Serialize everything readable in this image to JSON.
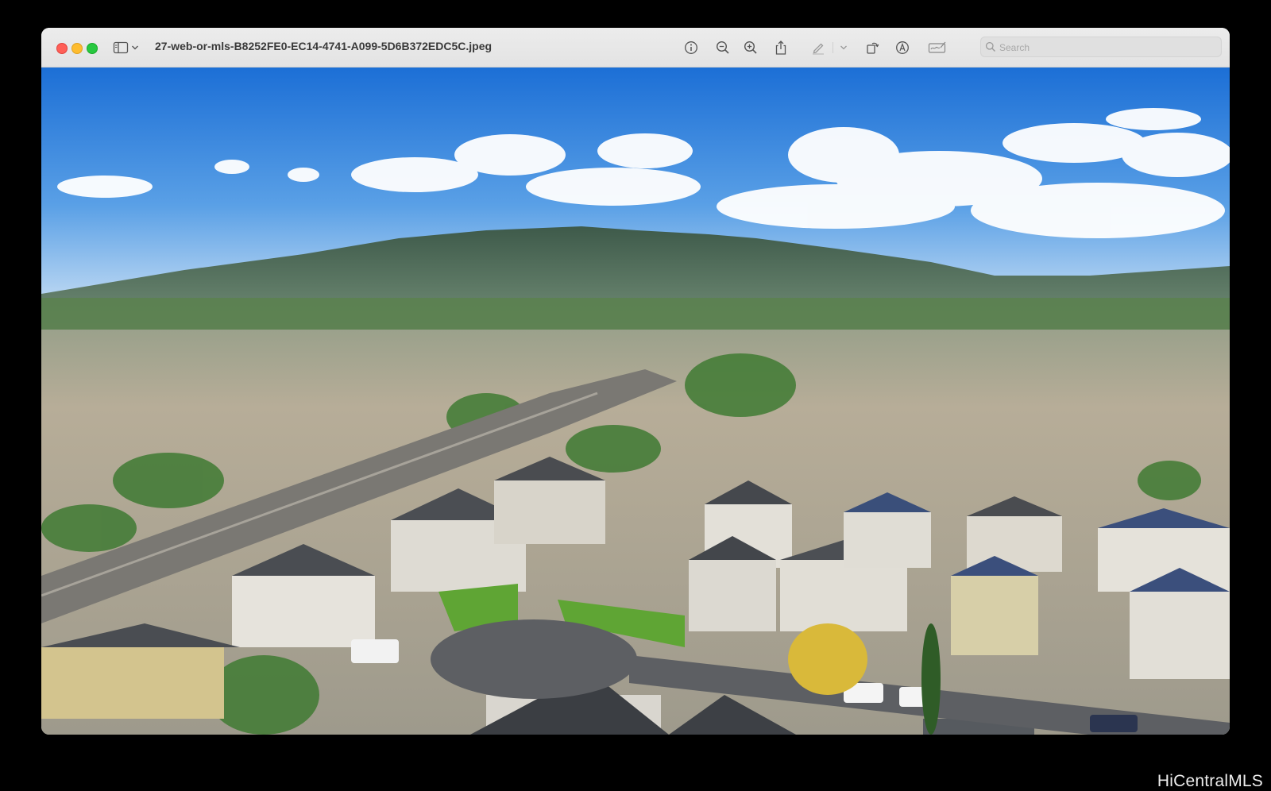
{
  "window": {
    "filename": "27-web-or-mls-B8252FE0-EC14-4741-A099-5D6B372EDC5C.jpeg"
  },
  "toolbar": {
    "icons": [
      "sidebar-icon",
      "chevron-down-icon",
      "info-icon",
      "zoom-out-icon",
      "zoom-in-icon",
      "share-icon",
      "highlight-pen-icon",
      "chevron-down-icon",
      "rotate-icon",
      "markup-icon",
      "signature-icon",
      "search-icon"
    ]
  },
  "search": {
    "placeholder": "Search",
    "value": ""
  },
  "photo": {
    "subject": "Aerial view of a residential subdivision with a cul-de-sac, houses with solar panels, a boulevard lined with palm trees, and mountains under a blue sky with clouds",
    "colors": {
      "sky_top": "#1c6fd6",
      "sky_bottom": "#a9cdf0",
      "mountain": "#4c6a55",
      "lawn": "#4f9a2c"
    }
  },
  "watermark": {
    "text": "HiCentralMLS"
  }
}
